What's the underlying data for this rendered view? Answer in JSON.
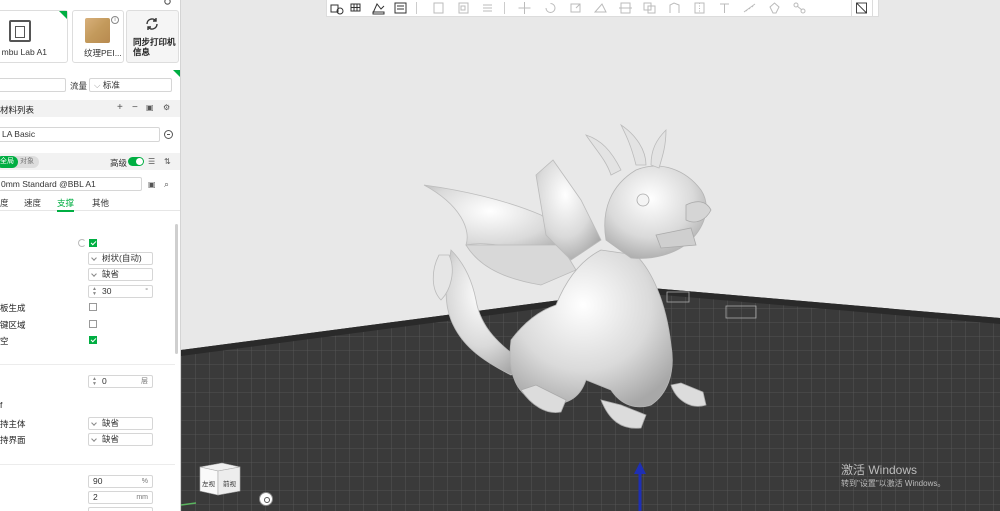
{
  "printer": {
    "label": "mbu Lab A1"
  },
  "plate": {
    "label": "纹理PEI..."
  },
  "sync": {
    "label": "同步打印机信息"
  },
  "flow": {
    "label": "流量",
    "value": "标准"
  },
  "filament_list": {
    "title": "材料列表"
  },
  "filament": {
    "name": "LA Basic"
  },
  "mode": {
    "global": "全局",
    "object": "对象",
    "advanced": "高级"
  },
  "profile": {
    "name": "0mm Standard @BBL A1"
  },
  "tabs": [
    "度",
    "速度",
    "支撑",
    "其他"
  ],
  "support": {
    "type_value": "树状(自动)",
    "style_value": "缺省",
    "threshold_value": "30",
    "row_raft": "板生成",
    "row_key": "键区域",
    "row_empty": "空",
    "raft_layers": "0",
    "row_body": "持主体",
    "row_interface": "持界面",
    "body_value": "缺省",
    "interface_value": "缺省",
    "row_bracket": "f",
    "percent_value": "90",
    "percent_unit": "%",
    "mm_value": "2",
    "mm_unit": "mm"
  },
  "viewport": {
    "view_cube_left": "左视",
    "view_cube_front": "前视",
    "watermark_line1": "激活 Windows",
    "watermark_line2": "转到\"设置\"以激活 Windows。"
  }
}
